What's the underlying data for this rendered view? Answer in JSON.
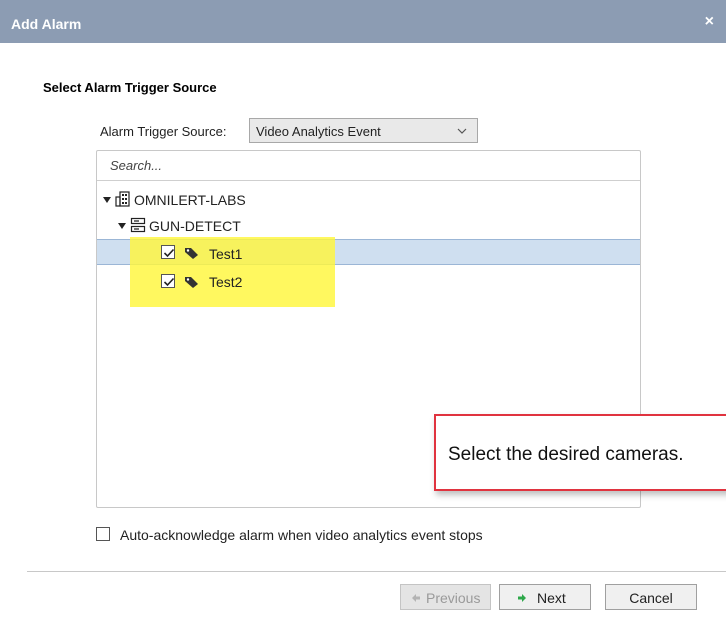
{
  "dialog": {
    "title": "Add Alarm",
    "close": "×"
  },
  "section": {
    "title": "Select Alarm Trigger Source"
  },
  "trigger_source": {
    "label": "Alarm Trigger Source:",
    "value": "Video Analytics Event"
  },
  "tree": {
    "search_placeholder": "Search...",
    "nodes": [
      {
        "label": "OMNILERT-LABS",
        "icon": "building-icon",
        "expanded": true
      },
      {
        "label": "GUN-DETECT",
        "icon": "server-icon",
        "expanded": true
      },
      {
        "label": "Test1",
        "icon": "tag-icon",
        "checked": true,
        "selected": true
      },
      {
        "label": "Test2",
        "icon": "tag-icon",
        "checked": true,
        "selected": false
      }
    ]
  },
  "callout": {
    "text": "Select the desired cameras."
  },
  "auto_ack": {
    "label": "Auto-acknowledge alarm when video analytics event stops",
    "checked": false
  },
  "buttons": {
    "previous": "Previous",
    "next": "Next",
    "cancel": "Cancel"
  },
  "colors": {
    "titlebar": "#8c9cb3",
    "selection": "#cfdff0",
    "highlight": "#fff73c",
    "callout_border": "#e0333f",
    "next_arrow": "#2ea84a"
  }
}
